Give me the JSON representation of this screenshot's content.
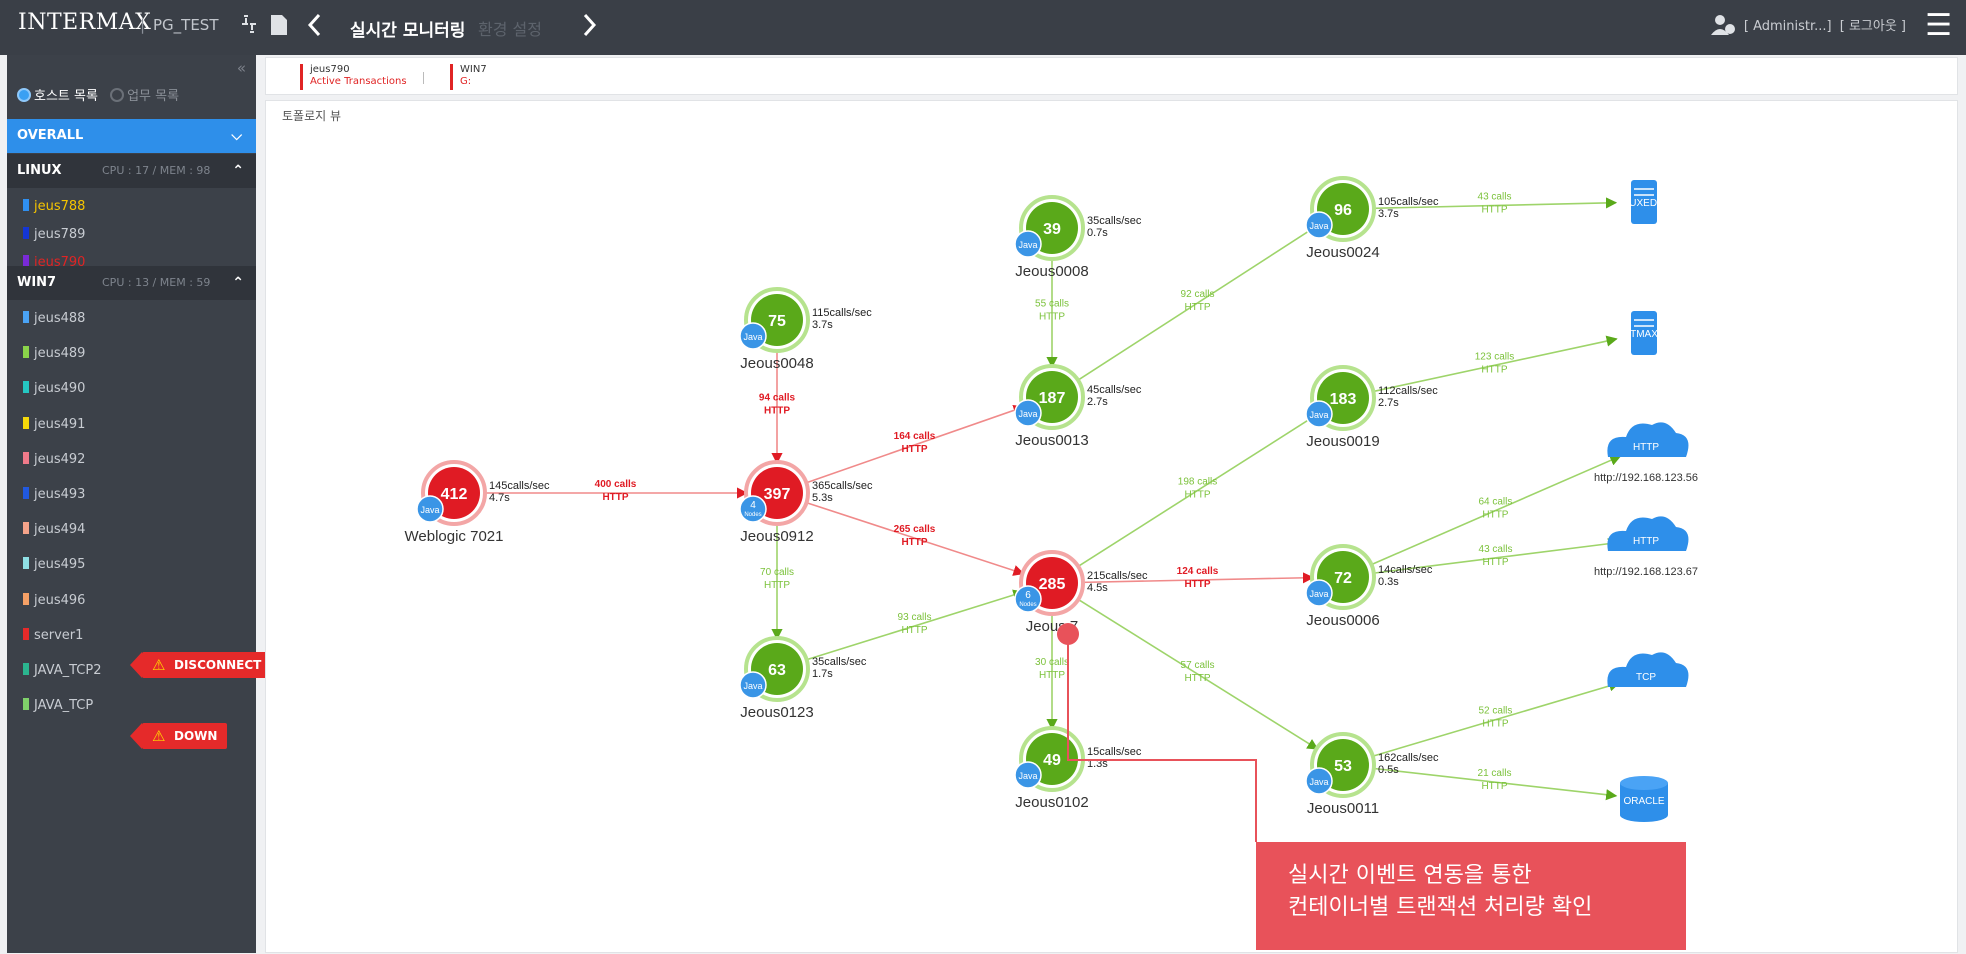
{
  "header": {
    "brand": "INTERMAX",
    "separator": "|",
    "project": "PG_TEST",
    "icons": [
      "connect-icon",
      "document-icon",
      "chevron-left-icon",
      "chevron-right-icon",
      "user-icon",
      "menu-icon"
    ],
    "nav_title": "실시간 모니터링",
    "nav_next": "환경 설정",
    "user_label": "[ Administr...]",
    "logout_label": "[ 로그아웃 ]"
  },
  "sidebar": {
    "collapse_glyph": "«",
    "radio": {
      "host_list": "호스트 목록",
      "task_list": "업무 목록"
    },
    "overall_label": "OVERALL",
    "groups": [
      {
        "name": "LINUX",
        "stats": "CPU : 17 / MEM : 98"
      },
      {
        "name": "WIN7",
        "stats": "CPU : 13 / MEM : 59"
      }
    ],
    "linux_hosts": [
      {
        "name": "jeus788",
        "color": "#2f8ff0",
        "text_color": "#f5c400"
      },
      {
        "name": "jeus789",
        "color": "#1436d6",
        "text_color": "#c8ccd2"
      },
      {
        "name": "jeus790",
        "color": "#7a2ad8",
        "text_color": "#e02424"
      }
    ],
    "win7_hosts": [
      {
        "name": "jeus488",
        "color": "#4aa3f5"
      },
      {
        "name": "jeus489",
        "color": "#8bd34a"
      },
      {
        "name": "jeus490",
        "color": "#25c7c2"
      },
      {
        "name": "jeus491",
        "color": "#f5d90a"
      },
      {
        "name": "jeus492",
        "color": "#f07a8a"
      },
      {
        "name": "jeus493",
        "color": "#2159e0"
      },
      {
        "name": "jeus494",
        "color": "#f5a38a"
      },
      {
        "name": "jeus495",
        "color": "#8fe0e5"
      },
      {
        "name": "jeus496",
        "color": "#f5a066"
      },
      {
        "name": "server1",
        "color": "#e52a2a"
      },
      {
        "name": "JAVA_TCP2",
        "color": "#2bb58f"
      },
      {
        "name": "JAVA_TCP",
        "color": "#7fd16a"
      }
    ],
    "badges": {
      "server1": "DISCONNECT",
      "java_tcp": "DOWN"
    }
  },
  "tabs": [
    {
      "title": "jeus790",
      "subtitle": "Active Transactions"
    },
    {
      "title": "WIN7",
      "subtitle": "G:"
    }
  ],
  "panel_title": "토폴로지 뷰",
  "topology": {
    "nodes": [
      {
        "id": "weblogic",
        "value": "412",
        "status": "red",
        "java": "Java",
        "label": "Weblogic 7021",
        "rate": "145calls/sec",
        "time": "4.7s"
      },
      {
        "id": "jeus0912",
        "value": "397",
        "status": "red",
        "java": "4",
        "java_sub": "Nodes",
        "label": "Jeous0912",
        "rate": "365calls/sec",
        "time": "5.3s"
      },
      {
        "id": "jeus0048",
        "value": "75",
        "status": "green",
        "java": "Java",
        "label": "Jeous0048",
        "rate": "115calls/sec",
        "time": "3.7s"
      },
      {
        "id": "jeus0123",
        "value": "63",
        "status": "green",
        "java": "Java",
        "label": "Jeous0123",
        "rate": "35calls/sec",
        "time": "1.7s"
      },
      {
        "id": "jeus0008",
        "value": "39",
        "status": "green",
        "java": "Java",
        "label": "Jeous0008",
        "rate": "35calls/sec",
        "time": "0.7s"
      },
      {
        "id": "jeus0013",
        "value": "187",
        "status": "green",
        "java": "Java",
        "label": "Jeous0013",
        "rate": "45calls/sec",
        "time": "2.7s"
      },
      {
        "id": "jeus0007",
        "value": "285",
        "status": "red",
        "java": "6",
        "java_sub": "Nodes",
        "label": "Jeous 7",
        "rate": "215calls/sec",
        "time": "4.5s"
      },
      {
        "id": "jeus0102",
        "value": "49",
        "status": "green",
        "java": "Java",
        "label": "Jeous0102",
        "rate": "15calls/sec",
        "time": "1.3s"
      },
      {
        "id": "jeus0024",
        "value": "96",
        "status": "green",
        "java": "Java",
        "label": "Jeous0024",
        "rate": "105calls/sec",
        "time": "3.7s"
      },
      {
        "id": "jeus0019",
        "value": "183",
        "status": "green",
        "java": "Java",
        "label": "Jeous0019",
        "rate": "112calls/sec",
        "time": "2.7s"
      },
      {
        "id": "jeus0006",
        "value": "72",
        "status": "green",
        "java": "Java",
        "label": "Jeous0006",
        "rate": "14calls/sec",
        "time": "0.3s"
      },
      {
        "id": "jeus0011",
        "value": "53",
        "status": "green",
        "java": "Java",
        "label": "Jeous0011",
        "rate": "162calls/sec",
        "time": "0.5s"
      }
    ],
    "targets": [
      {
        "id": "tuxedo",
        "kind": "server",
        "label": "TUXEDO"
      },
      {
        "id": "tmax",
        "kind": "server",
        "label": "TMAX"
      },
      {
        "id": "http1",
        "kind": "cloud",
        "label": "HTTP",
        "caption": "http://192.168.123.56"
      },
      {
        "id": "http2",
        "kind": "cloud",
        "label": "HTTP",
        "caption": "http://192.168.123.67"
      },
      {
        "id": "tcp",
        "kind": "cloud",
        "label": "TCP"
      },
      {
        "id": "oracle",
        "kind": "db",
        "label": "ORACLE"
      }
    ],
    "edges": [
      {
        "from": "weblogic",
        "to": "jeus0912",
        "calls": "400 calls",
        "proto": "HTTP",
        "status": "red"
      },
      {
        "from": "jeus0048",
        "to": "jeus0912",
        "calls": "94 calls",
        "proto": "HTTP",
        "status": "red"
      },
      {
        "from": "jeus0912",
        "to": "jeus0013",
        "calls": "164 calls",
        "proto": "HTTP",
        "status": "red"
      },
      {
        "from": "jeus0912",
        "to": "jeus0007",
        "calls": "265 calls",
        "proto": "HTTP",
        "status": "red"
      },
      {
        "from": "jeus0912",
        "to": "jeus0123",
        "calls": "70 calls",
        "proto": "HTTP",
        "status": "green"
      },
      {
        "from": "jeus0123",
        "to": "jeus0007",
        "calls": "93 calls",
        "proto": "HTTP",
        "status": "green"
      },
      {
        "from": "jeus0008",
        "to": "jeus0013",
        "calls": "55 calls",
        "proto": "HTTP",
        "status": "green"
      },
      {
        "from": "jeus0013",
        "to": "jeus0024",
        "calls": "92 calls",
        "proto": "HTTP",
        "status": "green"
      },
      {
        "from": "jeus0007",
        "to": "jeus0019",
        "calls": "198 calls",
        "proto": "HTTP",
        "status": "green"
      },
      {
        "from": "jeus0007",
        "to": "jeus0006",
        "calls": "124 calls",
        "proto": "HTTP",
        "status": "red"
      },
      {
        "from": "jeus0007",
        "to": "jeus0102",
        "calls": "30 calls",
        "proto": "HTTP",
        "status": "green"
      },
      {
        "from": "jeus0007",
        "to": "jeus0011",
        "calls": "57 calls",
        "proto": "HTTP",
        "status": "green"
      },
      {
        "from": "jeus0024",
        "to": "tuxedo",
        "calls": "43 calls",
        "proto": "HTTP",
        "status": "green"
      },
      {
        "from": "jeus0019",
        "to": "tmax",
        "calls": "123 calls",
        "proto": "HTTP",
        "status": "green"
      },
      {
        "from": "jeus0006",
        "to": "http1",
        "calls": "64 calls",
        "proto": "HTTP",
        "status": "green"
      },
      {
        "from": "jeus0006",
        "to": "http2",
        "calls": "43 calls",
        "proto": "HTTP",
        "status": "green"
      },
      {
        "from": "jeus0011",
        "to": "tcp",
        "calls": "52 calls",
        "proto": "HTTP",
        "status": "green"
      },
      {
        "from": "jeus0011",
        "to": "oracle",
        "calls": "21 calls",
        "proto": "HTTP",
        "status": "green"
      }
    ]
  },
  "annotation": {
    "line1": "실시간 이벤트 연동을 통한",
    "line2": "컨테이너별 트랜잭션 처리량 확인"
  },
  "colors": {
    "red": "#e01b24",
    "green": "#5aa91a",
    "java_blue": "#3a95e6",
    "red_edge": "#f08a8a",
    "green_edge": "#9ed46a",
    "accent": "#2e8fea"
  }
}
